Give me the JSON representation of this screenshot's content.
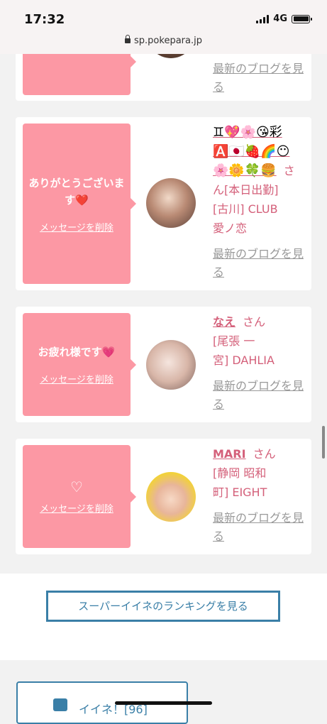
{
  "status_bar": {
    "time": "17:32",
    "network": "4G",
    "url": "sp.pokepara.jp"
  },
  "cards": [
    {
      "blog_link": "最新のブログを見る"
    },
    {
      "message": "ありがとうございます❤️",
      "delete_label": "メッセージを削除",
      "name_emoji_line1": "♊💖🌸😘彩",
      "name_emoji_line2": "🅰️🇯🇵🍓🌈😶",
      "name_emoji_line3": "🌸🌼🍀🍔",
      "san": "さ",
      "shop_line1": "ん[本日出勤]",
      "shop_line2": "[古川] CLUB",
      "shop_line3": "愛ノ恋",
      "blog_link": "最新のブログを見る"
    },
    {
      "message": "お疲れ様です💗",
      "delete_label": "メッセージを削除",
      "name": "なえ",
      "san": "さん",
      "shop_line1": "[尾張 一",
      "shop_line2": "宮] DAHLIA",
      "blog_link": "最新のブログを見る"
    },
    {
      "message": "♡",
      "delete_label": "メッセージを削除",
      "name": "MARI",
      "san": "さん",
      "shop_line1": "[静岡 昭和",
      "shop_line2": "町] EIGHT",
      "blog_link": "最新のブログを見る"
    }
  ],
  "ranking_button": "スーパーイイネのランキングを見る",
  "like_button": "イイネ！[96]",
  "colors": {
    "pink": "#fc98a4",
    "name": "#d4607a",
    "accent": "#3a7fa7"
  }
}
